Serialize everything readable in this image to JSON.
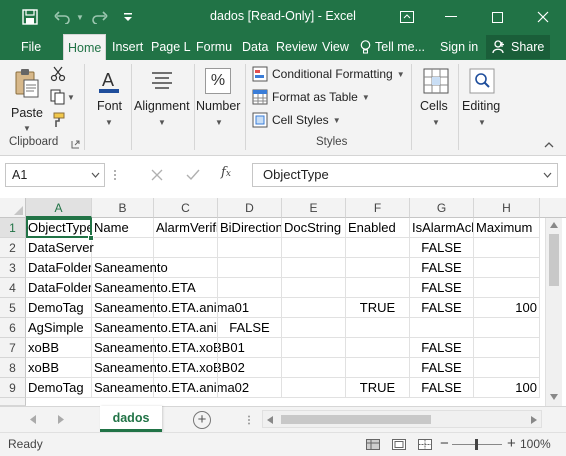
{
  "window": {
    "title": "dados  [Read-Only] - Excel",
    "accent_color": "#217346"
  },
  "ribbon_tabs": [
    "File",
    "Home",
    "Insert",
    "Page L",
    "Formu",
    "Data",
    "Review",
    "View"
  ],
  "ribbon_right": {
    "tell_me": "Tell me...",
    "sign_in": "Sign in",
    "share": "Share"
  },
  "ribbon": {
    "clipboard": {
      "paste_label": "Paste",
      "group_label": "Clipboard"
    },
    "font_label": "Font",
    "alignment_label": "Alignment",
    "number_label": "Number",
    "number_icon_text": "%",
    "styles": {
      "conditional_formatting": "Conditional Formatting",
      "format_as_table": "Format as Table",
      "cell_styles": "Cell Styles",
      "group_label": "Styles"
    },
    "cells_label": "Cells",
    "editing_label": "Editing"
  },
  "formula_bar": {
    "name_box": "A1",
    "formula_value": "ObjectType"
  },
  "columns": [
    "A",
    "B",
    "C",
    "D",
    "E",
    "F",
    "G",
    "H"
  ],
  "rows": [
    {
      "num": "1",
      "cells": [
        "ObjectType",
        "Name",
        "AlarmVerifiedBy",
        "BiDirectional",
        "DocString",
        "Enabled",
        "IsAlarmAcked",
        "Maximum"
      ]
    },
    {
      "num": "2",
      "cells": [
        "DataServer",
        "",
        "",
        "",
        "",
        "",
        "FALSE",
        ""
      ]
    },
    {
      "num": "3",
      "cells": [
        "DataFolder",
        "Saneamento",
        "",
        "",
        "",
        "",
        "FALSE",
        ""
      ]
    },
    {
      "num": "4",
      "cells": [
        "DataFolder",
        "Saneamento.ETA",
        "",
        "",
        "",
        "",
        "FALSE",
        ""
      ]
    },
    {
      "num": "5",
      "cells": [
        "DemoTag",
        "Saneamento.ETA.anima01",
        "",
        "",
        "",
        "TRUE",
        "FALSE",
        "100"
      ]
    },
    {
      "num": "6",
      "cells": [
        "AgSimple",
        "Saneamento.ETA.anima",
        "",
        "FALSE",
        "",
        "",
        "",
        ""
      ]
    },
    {
      "num": "7",
      "cells": [
        "xoBB",
        "Saneamento.ETA.xoBB01",
        "",
        "",
        "",
        "",
        "FALSE",
        ""
      ]
    },
    {
      "num": "8",
      "cells": [
        "xoBB",
        "Saneamento.ETA.xoBB02",
        "",
        "",
        "",
        "",
        "FALSE",
        ""
      ]
    },
    {
      "num": "9",
      "cells": [
        "DemoTag",
        "Saneamento.ETA.anima02",
        "",
        "",
        "",
        "TRUE",
        "FALSE",
        "100"
      ]
    }
  ],
  "sheet_tab": "dados",
  "status": {
    "ready": "Ready",
    "zoom": "100%",
    "zoom_minus": "−",
    "zoom_plus": "+"
  }
}
